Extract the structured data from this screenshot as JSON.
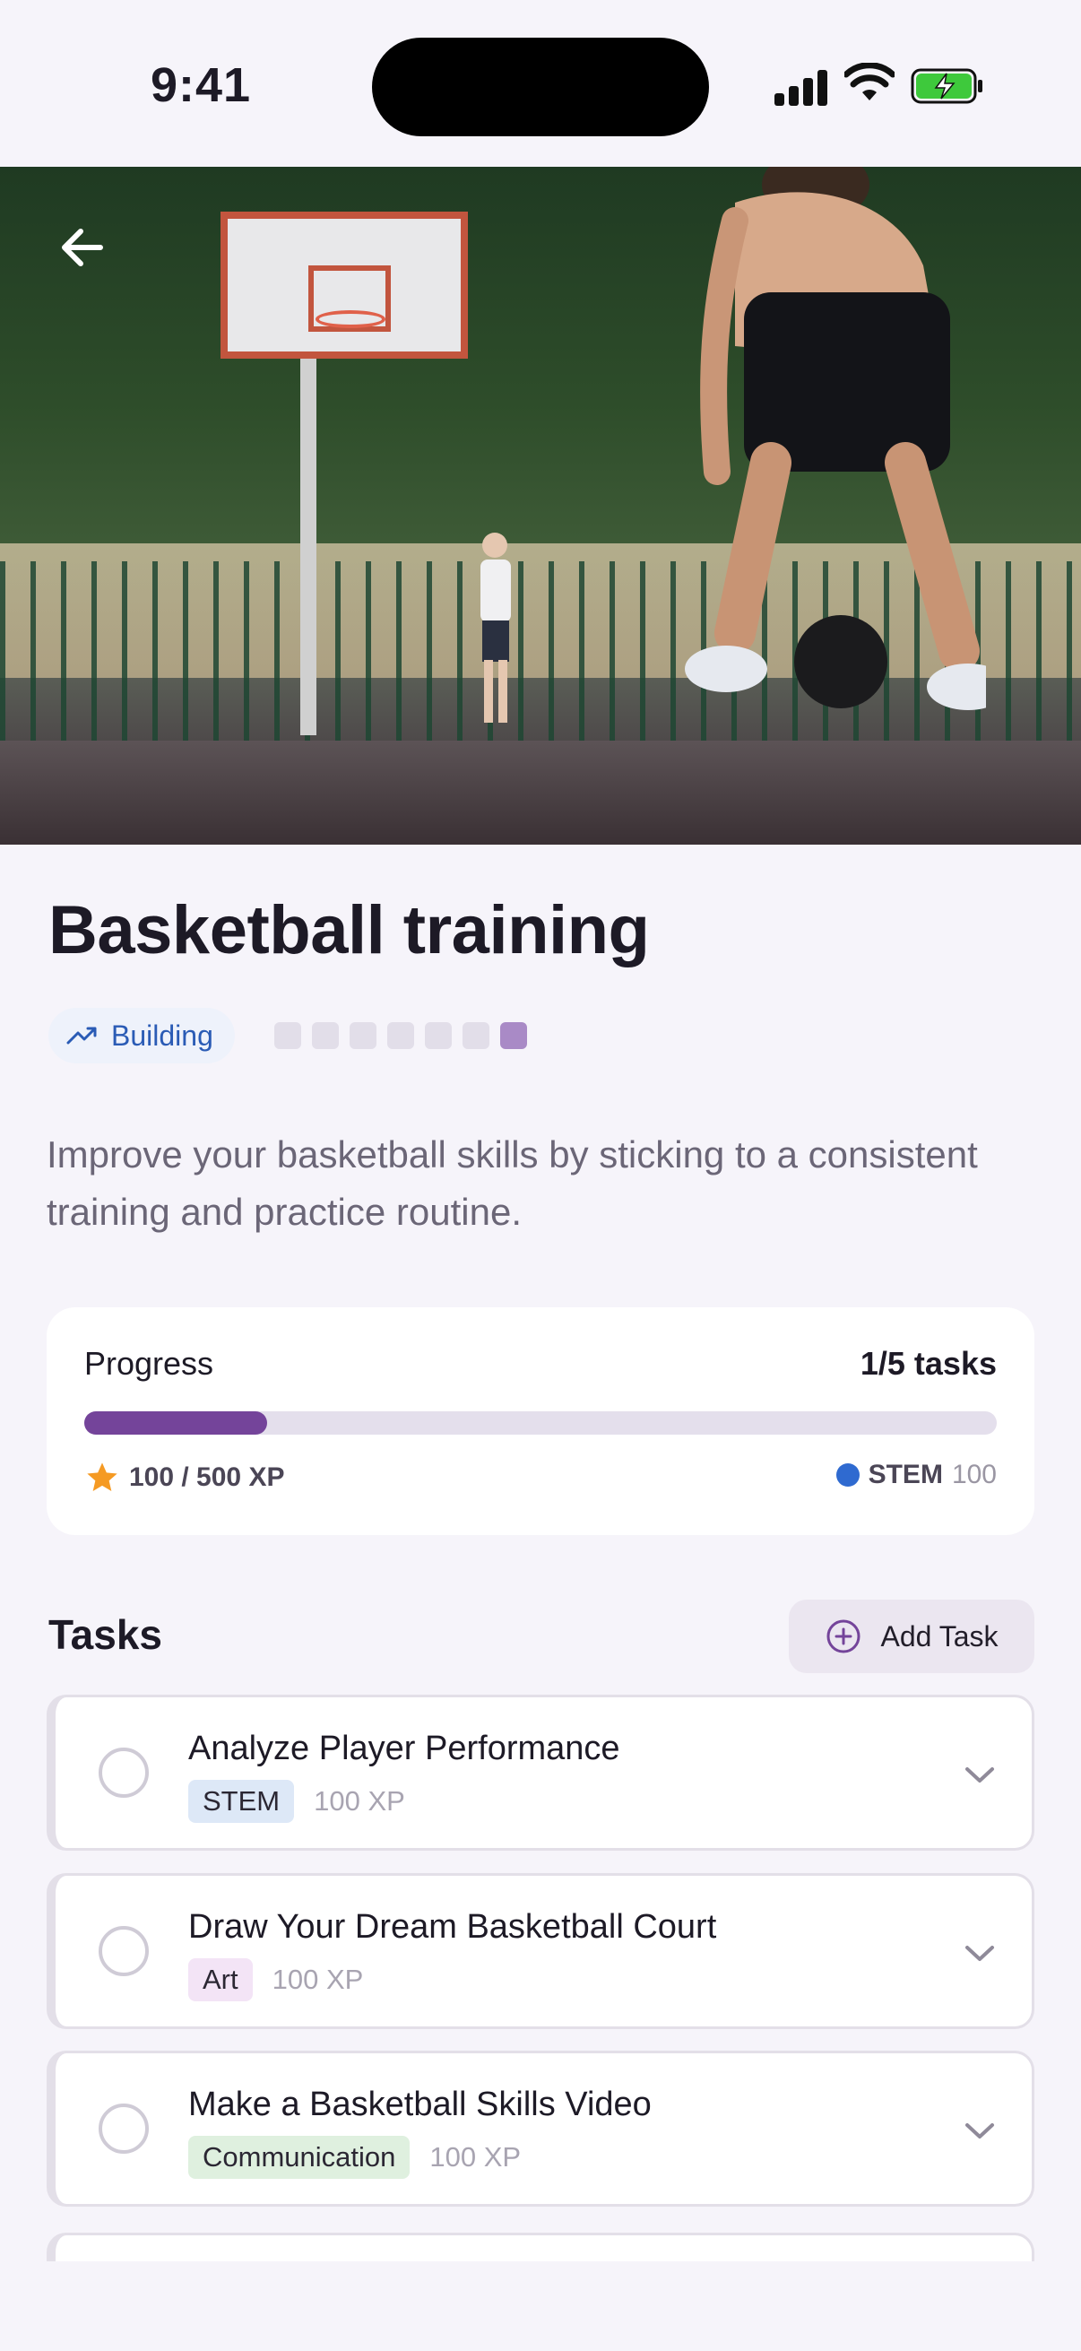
{
  "status_bar": {
    "time": "9:41"
  },
  "hero": {
    "image_alt": "Basketball player dribbling on outdoor court"
  },
  "page": {
    "title": "Basketball training",
    "stage_label": "Building",
    "stage_steps": 7,
    "stage_current": 7,
    "description": "Improve your basketball skills by sticking to a consistent training and practice routine."
  },
  "progress": {
    "label": "Progress",
    "count": "1/5 tasks",
    "fraction": 0.2,
    "xp_text": "100 / 500 XP",
    "category_name": "STEM",
    "category_value": "100"
  },
  "tasks_section": {
    "heading": "Tasks",
    "add_label": "Add Task"
  },
  "tasks": [
    {
      "name": "Analyze Player Performance",
      "category": "STEM",
      "xp": "100 XP"
    },
    {
      "name": "Draw Your Dream Basketball Court",
      "category": "Art",
      "xp": "100 XP"
    },
    {
      "name": "Make a Basketball Skills Video",
      "category": "Communication",
      "xp": "100 XP"
    }
  ],
  "colors": {
    "accent": "#74449a",
    "stem_dot": "#2f6ad0",
    "star": "#f59a23",
    "building_text": "#2a5bb5"
  }
}
